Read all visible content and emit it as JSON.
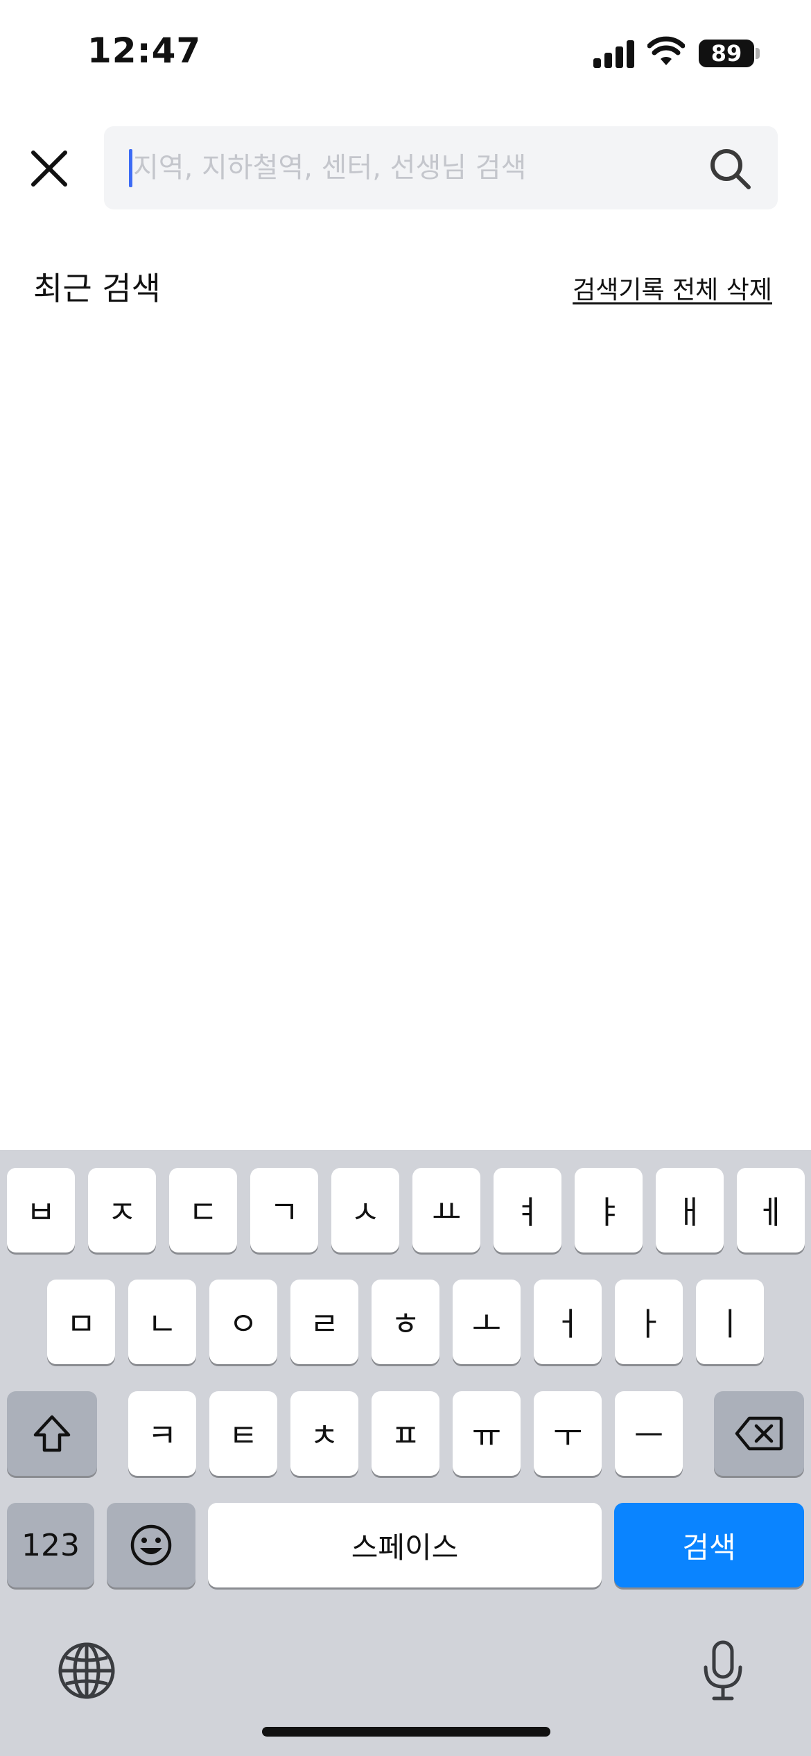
{
  "status_bar": {
    "time": "12:47",
    "battery": "89"
  },
  "search": {
    "placeholder": "지역, 지하철역, 센터, 선생님 검색",
    "value": ""
  },
  "recent": {
    "title": "최근 검색",
    "clear_label": "검색기록 전체 삭제"
  },
  "keyboard": {
    "row1": [
      "ㅂ",
      "ㅈ",
      "ㄷ",
      "ㄱ",
      "ㅅ",
      "ㅛ",
      "ㅕ",
      "ㅑ",
      "ㅐ",
      "ㅔ"
    ],
    "row2": [
      "ㅁ",
      "ㄴ",
      "ㅇ",
      "ㄹ",
      "ㅎ",
      "ㅗ",
      "ㅓ",
      "ㅏ",
      "ㅣ"
    ],
    "row3": [
      "ㅋ",
      "ㅌ",
      "ㅊ",
      "ㅍ",
      "ㅠ",
      "ㅜ",
      "ㅡ"
    ],
    "numbers_label": "123",
    "space_label": "스페이스",
    "search_label": "검색",
    "icons": [
      "shift-icon",
      "backspace-icon",
      "emoji-icon",
      "globe-icon",
      "microphone-icon"
    ],
    "accent_color": "#0a84ff"
  }
}
